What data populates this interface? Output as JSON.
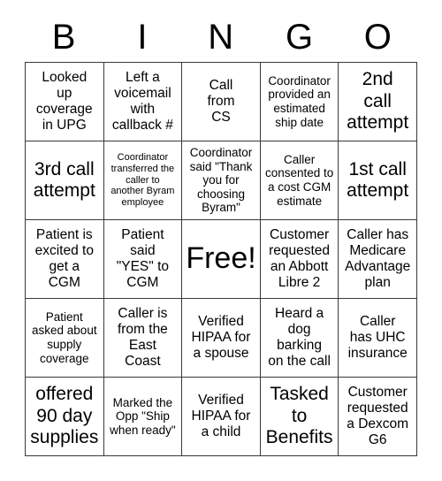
{
  "header": {
    "letters": [
      "B",
      "I",
      "N",
      "G",
      "O"
    ]
  },
  "grid": {
    "rows": [
      [
        {
          "text": "Looked\nup\ncoverage\nin UPG",
          "size": "md"
        },
        {
          "text": "Left a\nvoicemail\nwith\ncallback #",
          "size": "md"
        },
        {
          "text": "Call\nfrom\nCS",
          "size": "md"
        },
        {
          "text": "Coordinator\nprovided an\nestimated\nship date",
          "size": "sm"
        },
        {
          "text": "2nd\ncall\nattempt",
          "size": "lg"
        }
      ],
      [
        {
          "text": "3rd call\nattempt",
          "size": "lg"
        },
        {
          "text": "Coordinator\ntransferred the\ncaller to\nanother Byram\nemployee",
          "size": "xs"
        },
        {
          "text": "Coordinator\nsaid \"Thank\nyou for\nchoosing\nByram\"",
          "size": "sm"
        },
        {
          "text": "Caller\nconsented to\na cost CGM\nestimate",
          "size": "sm"
        },
        {
          "text": "1st call\nattempt",
          "size": "lg"
        }
      ],
      [
        {
          "text": "Patient is\nexcited to\nget a\nCGM",
          "size": "md"
        },
        {
          "text": "Patient\nsaid\n\"YES\" to\nCGM",
          "size": "md"
        },
        {
          "text": "Free!",
          "size": "xl"
        },
        {
          "text": "Customer\nrequested\nan Abbott\nLibre 2",
          "size": "md"
        },
        {
          "text": "Caller has\nMedicare\nAdvantage\nplan",
          "size": "md"
        }
      ],
      [
        {
          "text": "Patient\nasked about\nsupply\ncoverage",
          "size": "sm"
        },
        {
          "text": "Caller is\nfrom the\nEast\nCoast",
          "size": "md"
        },
        {
          "text": "Verified\nHIPAA for\na spouse",
          "size": "md"
        },
        {
          "text": "Heard a\ndog\nbarking\non the call",
          "size": "md"
        },
        {
          "text": "Caller\nhas UHC\ninsurance",
          "size": "md"
        }
      ],
      [
        {
          "text": "offered\n90 day\nsupplies",
          "size": "lg"
        },
        {
          "text": "Marked the\nOpp \"Ship\nwhen ready\"",
          "size": "sm"
        },
        {
          "text": "Verified\nHIPAA for\na child",
          "size": "md"
        },
        {
          "text": "Tasked\nto\nBenefits",
          "size": "lg"
        },
        {
          "text": "Customer\nrequested\na Dexcom\nG6",
          "size": "md"
        }
      ]
    ]
  },
  "colors": {
    "text": "#000000",
    "border": "#3a3a3a",
    "background": "#ffffff"
  }
}
